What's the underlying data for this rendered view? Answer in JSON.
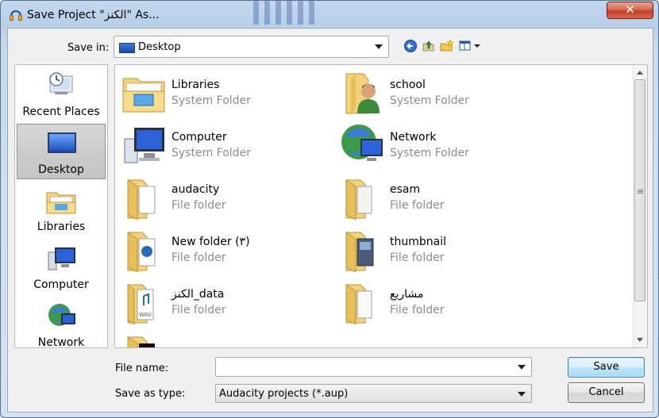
{
  "window": {
    "title": "Save Project \"الكنز\" As...",
    "close_label": "✕"
  },
  "save_in": {
    "label": "Save in:",
    "value": "Desktop"
  },
  "toolbar": {
    "icons": [
      "back-icon",
      "up-folder-icon",
      "new-folder-icon",
      "view-menu-icon"
    ]
  },
  "places": [
    {
      "label": "Recent Places",
      "icon": "recent-places-icon",
      "selected": false
    },
    {
      "label": "Desktop",
      "icon": "desktop-icon",
      "selected": true
    },
    {
      "label": "Libraries",
      "icon": "libraries-icon",
      "selected": false
    },
    {
      "label": "Computer",
      "icon": "computer-icon",
      "selected": false
    },
    {
      "label": "Network",
      "icon": "network-icon",
      "selected": false
    }
  ],
  "files": [
    {
      "name": "Libraries",
      "type": "System Folder",
      "icon": "libraries-folder-icon"
    },
    {
      "name": "school",
      "type": "System Folder",
      "icon": "user-folder-icon"
    },
    {
      "name": "Computer",
      "type": "System Folder",
      "icon": "computer-icon"
    },
    {
      "name": "Network",
      "type": "System Folder",
      "icon": "network-globe-icon"
    },
    {
      "name": "audacity",
      "type": "File folder",
      "icon": "folder-icon"
    },
    {
      "name": "esam",
      "type": "File folder",
      "icon": "folder-icon"
    },
    {
      "name": "New folder (٣)",
      "type": "File folder",
      "icon": "folder-icon"
    },
    {
      "name": "thumbnail",
      "type": "File folder",
      "icon": "folder-icon"
    },
    {
      "name": "الكنز_data",
      "type": "File folder",
      "icon": "wav-folder-icon"
    },
    {
      "name": "مشاريع",
      "type": "File folder",
      "icon": "folder-icon"
    }
  ],
  "file_name": {
    "label": "File name:",
    "value": ""
  },
  "save_as_type": {
    "label": "Save as type:",
    "value": "Audacity projects (*.aup)"
  },
  "buttons": {
    "save": "Save",
    "cancel": "Cancel"
  },
  "colors": {
    "folder_yellow": "#f2d27a",
    "selection_gray": "#c8c8c8",
    "accent_blue": "#3c7fb1"
  }
}
